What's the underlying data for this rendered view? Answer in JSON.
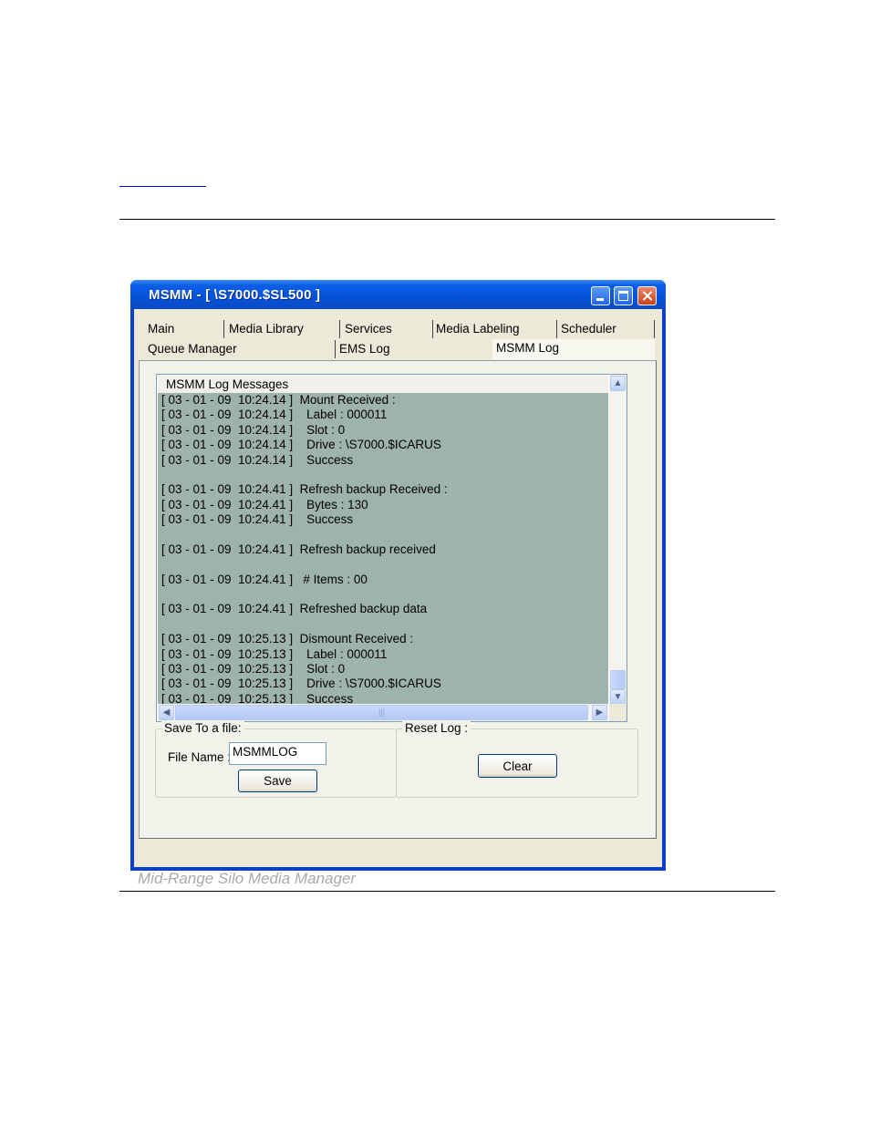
{
  "window": {
    "title": "MSMM - [ \\S7000.$SL500 ]"
  },
  "tabs": {
    "row1": [
      "Main",
      "Media Library",
      "Services",
      "Media Labeling",
      "Scheduler"
    ],
    "row2": [
      "Queue Manager",
      "EMS Log",
      "MSMM Log"
    ],
    "selected": "MSMM Log"
  },
  "log": {
    "header": "MSMM Log Messages",
    "lines": [
      "[ 03 - 01 - 09  10:24.14 ]  Mount Received :",
      "[ 03 - 01 - 09  10:24.14 ]    Label : 000011",
      "[ 03 - 01 - 09  10:24.14 ]    Slot : 0",
      "[ 03 - 01 - 09  10:24.14 ]    Drive : \\S7000.$ICARUS",
      "[ 03 - 01 - 09  10:24.14 ]    Success",
      "",
      "[ 03 - 01 - 09  10:24.41 ]  Refresh backup Received :",
      "[ 03 - 01 - 09  10:24.41 ]    Bytes : 130",
      "[ 03 - 01 - 09  10:24.41 ]    Success",
      "",
      "[ 03 - 01 - 09  10:24.41 ]  Refresh backup received",
      "",
      "[ 03 - 01 - 09  10:24.41 ]   # Items : 00",
      "",
      "[ 03 - 01 - 09  10:24.41 ]  Refreshed backup data",
      "",
      "[ 03 - 01 - 09  10:25.13 ]  Dismount Received :",
      "[ 03 - 01 - 09  10:25.13 ]    Label : 000011",
      "[ 03 - 01 - 09  10:25.13 ]    Slot : 0",
      "[ 03 - 01 - 09  10:25.13 ]    Drive : \\S7000.$ICARUS",
      "[ 03 - 01 - 09  10:25.13 ]    Success"
    ]
  },
  "save_group": {
    "legend": "Save To a file:",
    "file_name_label": "File Name :",
    "file_name_value": "MSMMLOG",
    "save_label": "Save"
  },
  "reset_group": {
    "legend": "Reset Log :",
    "clear_label": "Clear"
  },
  "footer": "Mid-Range Silo Media Manager",
  "colors": {
    "titlebar": "#0653d8",
    "log_background": "#9db3ac",
    "window_face": "#ece9d8"
  }
}
